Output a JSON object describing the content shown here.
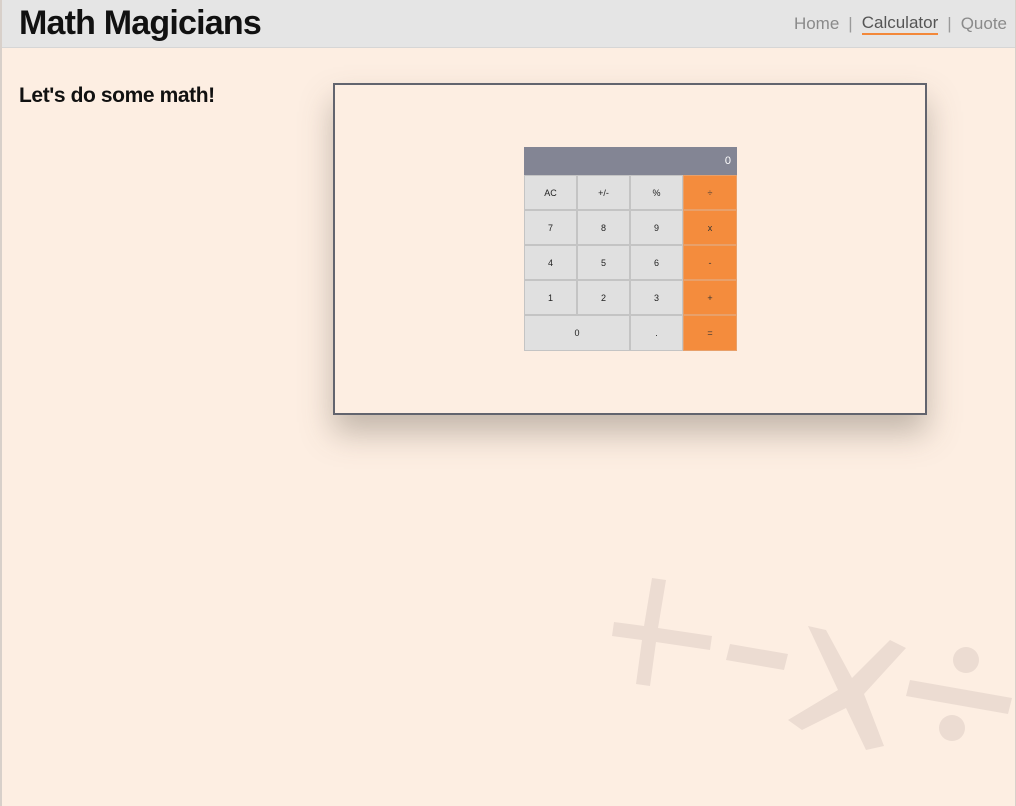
{
  "header": {
    "brand": "Math Magicians",
    "nav": [
      {
        "label": "Home",
        "active": false
      },
      {
        "label": "Calculator",
        "active": true
      },
      {
        "label": "Quote",
        "active": false
      }
    ],
    "separator": "|"
  },
  "main": {
    "intro": "Let's do some math!"
  },
  "calculator": {
    "display": "0",
    "rows": [
      [
        "AC",
        "+/-",
        "%",
        "÷"
      ],
      [
        "7",
        "8",
        "9",
        "x"
      ],
      [
        "4",
        "5",
        "6",
        "-"
      ],
      [
        "1",
        "2",
        "3",
        "+"
      ],
      [
        "0",
        ".",
        "="
      ]
    ]
  },
  "colors": {
    "accent": "#f48c3d",
    "display_bg": "#838594",
    "page_bg": "#fdeee2",
    "key_bg": "#e0e0e0"
  },
  "decoration": {
    "background_symbols": "plus-minus-times-divide"
  }
}
